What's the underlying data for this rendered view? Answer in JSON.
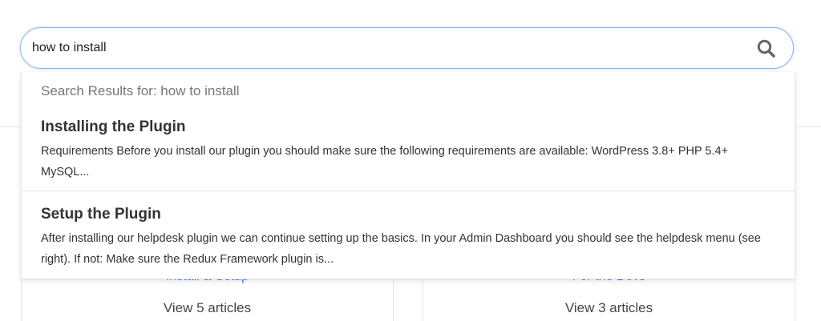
{
  "search": {
    "value": "how to install",
    "icon": "search-icon"
  },
  "results": {
    "heading": "Search Results for: how to install",
    "items": [
      {
        "title": "Installing the Plugin",
        "excerpt": "Requirements Before you install our plugin you should make sure the following requirements are available: WordPress 3.8+ PHP 5.4+ MySQL..."
      },
      {
        "title": "Setup the Plugin",
        "excerpt": "After installing our helpdesk plugin we can continue setting up the basics. In your Admin Dashboard you should see the helpdesk menu (see right). If not: Make sure the Redux Framework plugin is..."
      }
    ]
  },
  "background_cards": [
    {
      "title": "Install & Setup",
      "count": "View 5 articles"
    },
    {
      "title": "For the Devs",
      "count": "View 3 articles"
    }
  ],
  "colors": {
    "accent_border": "#8fb5e8",
    "link": "#3d7be0",
    "icon": "#666666"
  }
}
